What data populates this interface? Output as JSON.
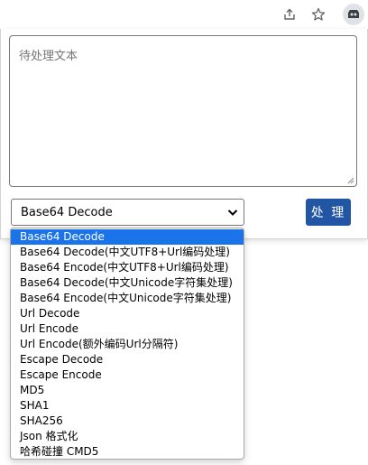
{
  "toolbar": {
    "icons": [
      "share-icon",
      "star-icon",
      "extension-icon"
    ]
  },
  "input": {
    "placeholder": "待处理文本"
  },
  "select": {
    "selected_label": "Base64 Decode"
  },
  "process_button": {
    "label": "处 理"
  },
  "dropdown": {
    "options": [
      "Base64 Decode",
      "Base64 Decode(中文UTF8+Url编码处理)",
      "Base64 Encode(中文UTF8+Url编码处理)",
      "Base64 Decode(中文Unicode字符集处理)",
      "Base64 Encode(中文Unicode字符集处理)",
      "Url Decode",
      "Url Encode",
      "Url Encode(额外编码Url分隔符)",
      "Escape Decode",
      "Escape Encode",
      "MD5",
      "SHA1",
      "SHA256",
      "Json 格式化",
      "哈希碰撞 CMD5"
    ],
    "selected_index": 0
  },
  "colors": {
    "accent": "#2255a4",
    "selected_option": "#1a73e8"
  }
}
